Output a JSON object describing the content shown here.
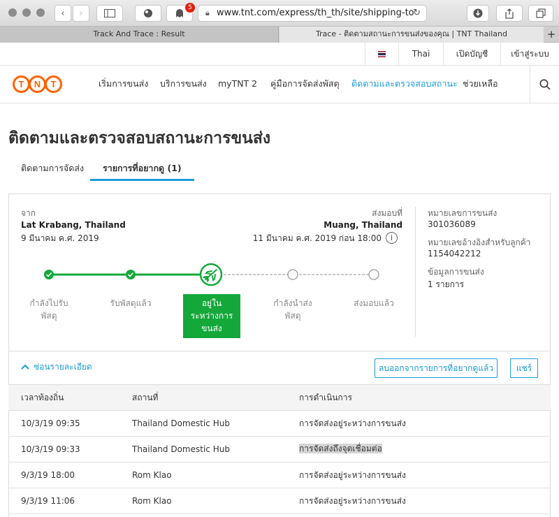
{
  "browser": {
    "url": "www.tnt.com/express/th_th/site/shipping-to",
    "notification_count": "5",
    "tabs": [
      "Track And Trace : Result",
      "Trace - ติดตามสถานะการขนส่งของคุณ | TNT Thailand"
    ]
  },
  "utility": {
    "language": "Thai",
    "open_account": "เปิดบัญชี",
    "login": "เข้าสู่ระบบ"
  },
  "logo": [
    "T",
    "N",
    "T"
  ],
  "nav": [
    "เริ่มการขนส่ง",
    "บริการขนส่ง",
    "myTNT 2",
    "คู่มือการจัดส่งพัสดุ",
    "ติดตามและตรวจสอบสถานะ",
    "ช่วยเหลือ"
  ],
  "page_title": "ติดตามและตรวจสอบสถานะการขนส่ง",
  "page_tabs": [
    "ติดตามการจัดส่ง",
    "รายการที่อยากดู (1)"
  ],
  "shipment": {
    "from_label": "จาก",
    "from_place": "Lat Krabang, Thailand",
    "from_date": "9 มีนาคม ค.ศ. 2019",
    "to_label": "ส่งมอบที่",
    "to_place": "Muang, Thailand",
    "to_date": "11 มีนาคม ค.ศ. 2019 ก่อน 18:00",
    "info_icon": "i",
    "tracking_label": "หมายเลขการขนส่ง",
    "tracking_value": "301036089",
    "ref_label": "หมายเลขอ้างอิงสำหรับลูกค้า",
    "ref_value": "1154042212",
    "info_label": "ข้อมูลการขนส่ง",
    "info_value": "1 รายการ"
  },
  "stages": [
    {
      "line1": "กำลังไปรับ",
      "line2": "พัสดุ"
    },
    {
      "line1": "รับพัสดุแล้ว",
      "line2": ""
    },
    {
      "line1": "อยู่ใน",
      "line2": "ระหว่างการ",
      "line3": "ขนส่ง"
    },
    {
      "line1": "กำลังนำส่ง",
      "line2": "พัสดุ"
    },
    {
      "line1": "ส่งมอบแล้ว",
      "line2": ""
    }
  ],
  "current_stage_index": 2,
  "actions": {
    "hide_details": "ซ่อนรายละเอียด",
    "remove": "ลบออกจากรายการที่อยากดูแล้ว",
    "share": "แชร์"
  },
  "table": {
    "headers": [
      "เวลาท้องถิ่น",
      "สถานที่",
      "การดำเนินการ"
    ],
    "rows": [
      [
        "10/3/19 09:35",
        "Thailand Domestic Hub",
        "การจัดส่งอยู่ระหว่างการขนส่ง"
      ],
      [
        "10/3/19 09:33",
        "Thailand Domestic Hub",
        "การจัดส่งถึงจุดเชื่อมต่อ"
      ],
      [
        "9/3/19 18:00",
        "Rom Klao",
        "การจัดส่งอยู่ระหว่างการขนส่ง"
      ],
      [
        "9/3/19 11:06",
        "Rom Klao",
        "การจัดส่งอยู่ระหว่างการขนส่ง"
      ]
    ]
  },
  "colors": {
    "brand": "#ff6200",
    "accent": "#1a9bd7",
    "progress": "#14a83a"
  }
}
